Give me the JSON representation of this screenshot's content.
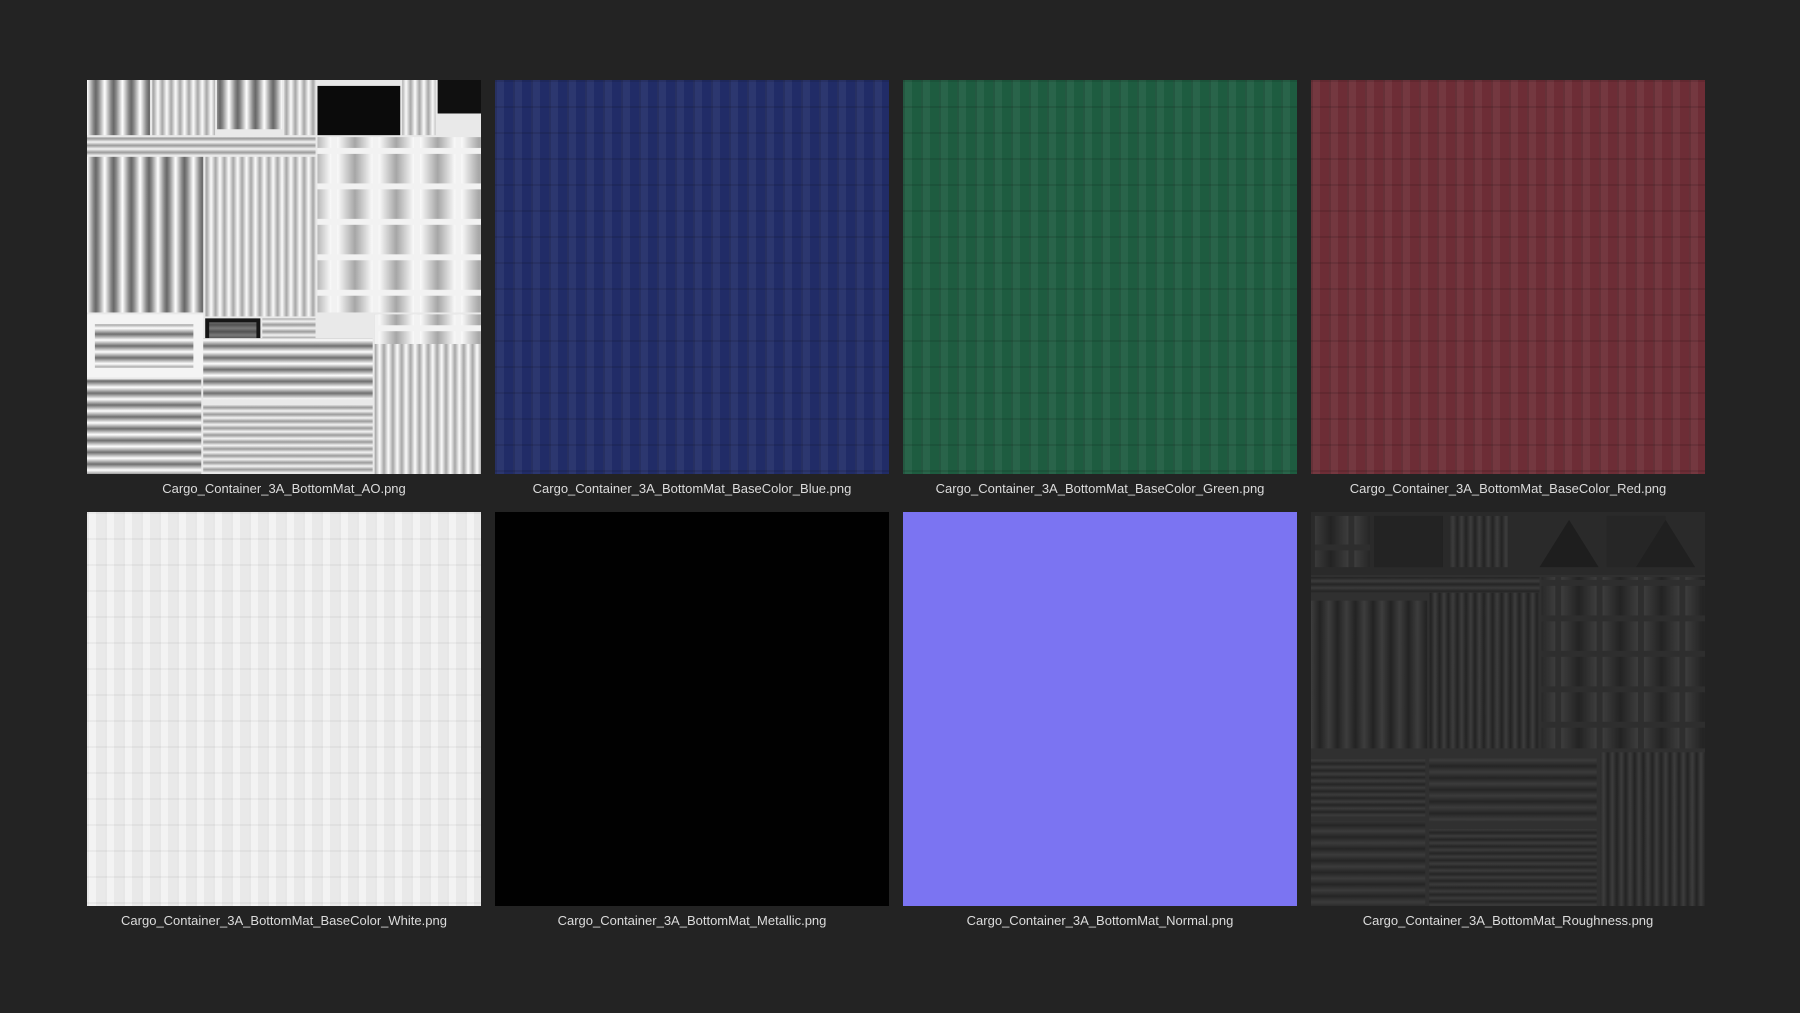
{
  "page": {
    "background_color": "#232323",
    "caption_color": "#dcdcdc"
  },
  "grid": {
    "items": [
      {
        "filename": "Cargo_Container_3A_BottomMat_AO.png",
        "map_type": "ambient-occlusion",
        "appearance": "black-and-white striped UV panel texture"
      },
      {
        "filename": "Cargo_Container_3A_BottomMat_BaseColor_Blue.png",
        "map_type": "base-color",
        "base_color": "#212c67"
      },
      {
        "filename": "Cargo_Container_3A_BottomMat_BaseColor_Green.png",
        "map_type": "base-color",
        "base_color": "#1e5c40"
      },
      {
        "filename": "Cargo_Container_3A_BottomMat_BaseColor_Red.png",
        "map_type": "base-color",
        "base_color": "#6d2d36"
      },
      {
        "filename": "Cargo_Container_3A_BottomMat_BaseColor_White.png",
        "map_type": "base-color",
        "base_color": "#e9e9e9"
      },
      {
        "filename": "Cargo_Container_3A_BottomMat_Metallic.png",
        "map_type": "metallic",
        "base_color": "#010101"
      },
      {
        "filename": "Cargo_Container_3A_BottomMat_Normal.png",
        "map_type": "normal",
        "base_color": "#7b74f2"
      },
      {
        "filename": "Cargo_Container_3A_BottomMat_Roughness.png",
        "map_type": "roughness",
        "base_color": "#303030",
        "appearance": "dark gray low-contrast striped UV panel texture"
      }
    ]
  }
}
